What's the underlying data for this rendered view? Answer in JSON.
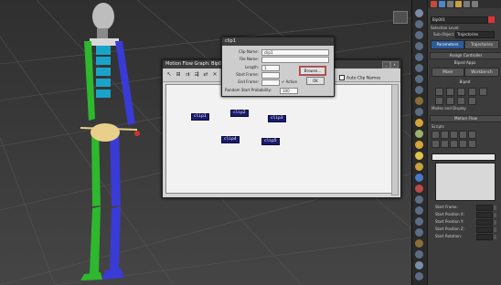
{
  "viewport": {
    "name": "3d-viewport"
  },
  "motion_flow_graph": {
    "title": "Motion Flow Graph: Bip0",
    "nodes": [
      "clip1",
      "clip2",
      "clip3",
      "clip4",
      "clip5"
    ],
    "auto_clip_names": "Auto Clip Names"
  },
  "clip_dialog": {
    "title": "clip1",
    "clip_name_label": "Clip Name:",
    "clip_name_value": "clip1",
    "file_name_label": "File Name:",
    "length_label": "Length:",
    "length_value": "1",
    "start_frame_label": "Start Frame:",
    "end_frame_label": "End Frame:",
    "random_label": "Random Start Probability:",
    "random_value": "100",
    "browse": "Browse...",
    "active": "Active",
    "ok": "OK"
  },
  "panel": {
    "name_field": "Bip001",
    "selection_level": "Selection Level:",
    "sub_object": "Sub-Object",
    "sub_object_value": "Trajectories",
    "parameters": "Parameters",
    "trajectories": "Trajectories",
    "assign_controller": "Assign Controller",
    "biped_apps": "Biped Apps",
    "mixer": "Mixer",
    "workbench": "Workbench",
    "biped": "Biped",
    "modes_display": "Modes and Display",
    "motion_flow": "Motion Flow",
    "scripts": "Scripts",
    "start_frame": "Start Frame:",
    "start_pos_x": "Start Position X:",
    "start_pos_y": "Start Position Y:",
    "start_pos_z": "Start Position Z:",
    "start_rotation": "Start Rotation:"
  }
}
